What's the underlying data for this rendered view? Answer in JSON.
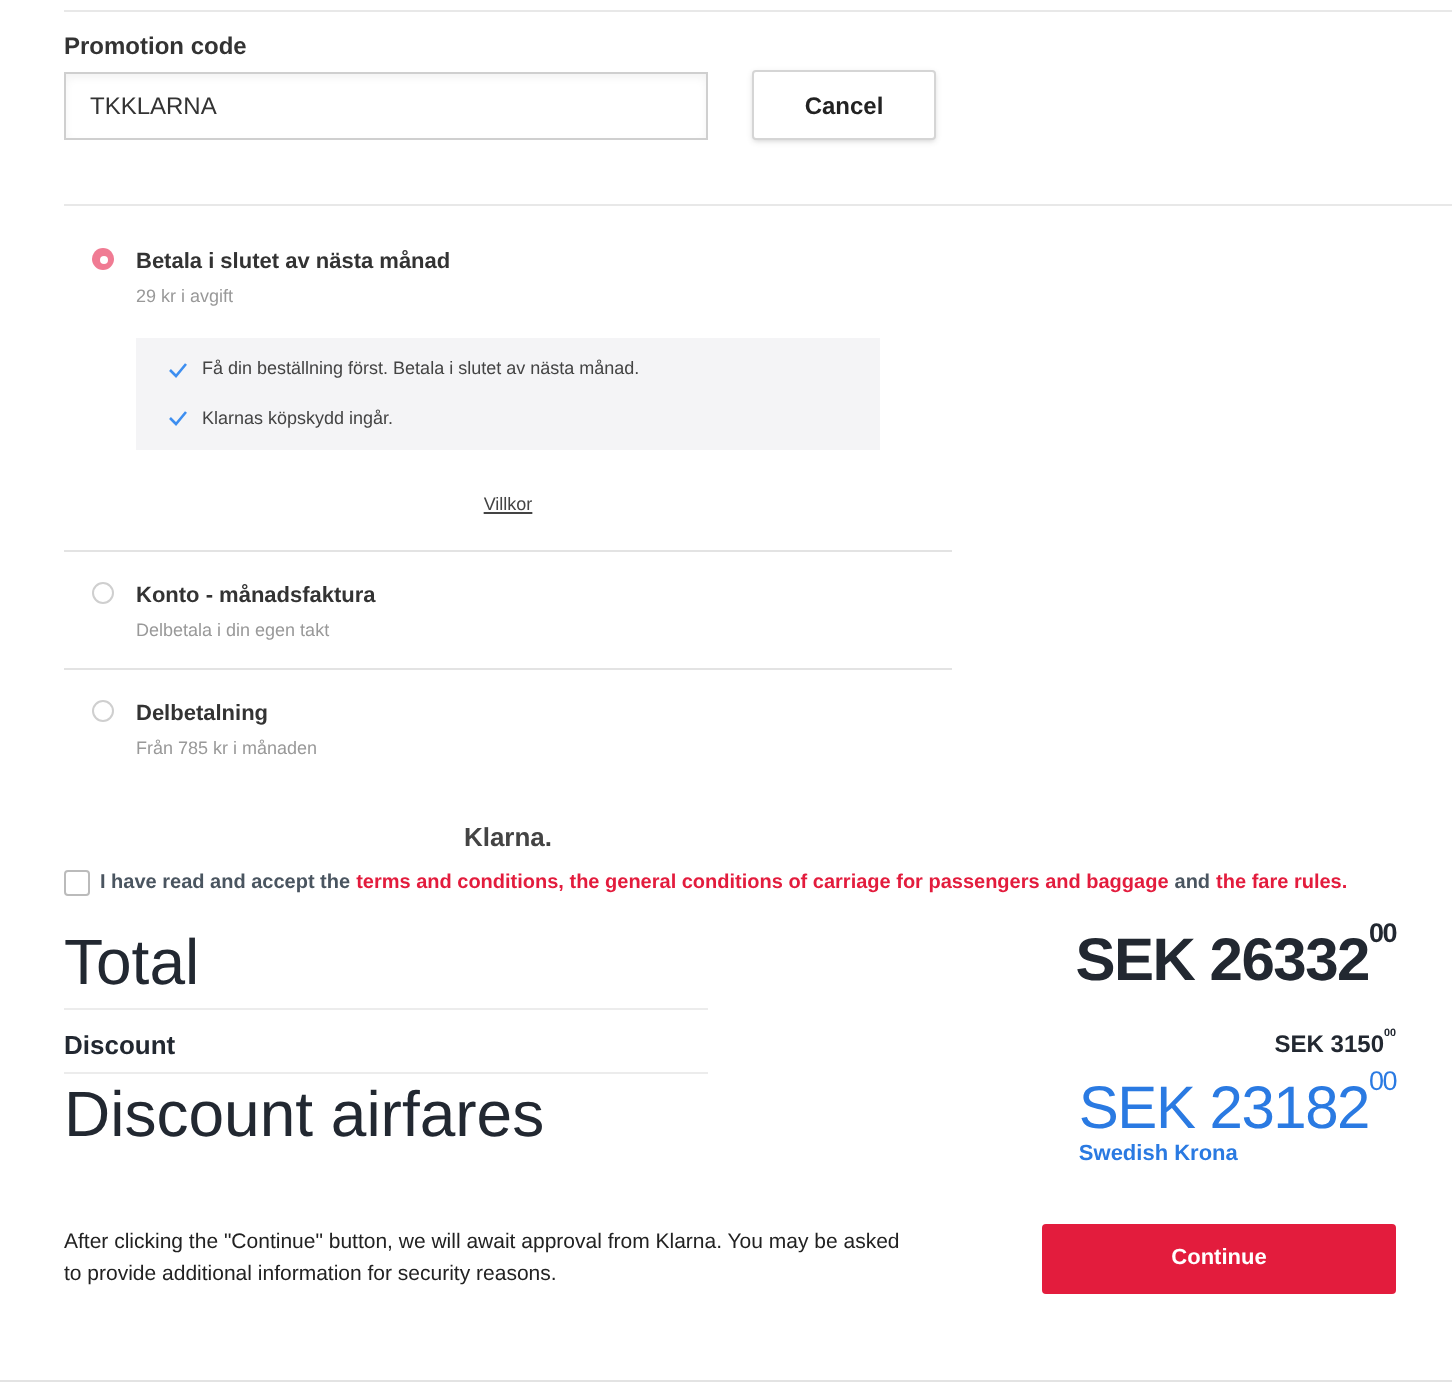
{
  "promotion": {
    "label": "Promotion code",
    "value": "TKKLARNA",
    "cancel_button": "Cancel"
  },
  "payment_options": [
    {
      "title": "Betala i slutet av nästa månad",
      "subtitle": "29 kr i avgift",
      "selected": true,
      "features": [
        "Få din beställning först. Betala i slutet av nästa månad.",
        "Klarnas köpskydd ingår."
      ],
      "link": "Villkor"
    },
    {
      "title": "Konto - månadsfaktura",
      "subtitle": "Delbetala i din egen takt",
      "selected": false
    },
    {
      "title": "Delbetalning",
      "subtitle": "Från 785 kr i månaden",
      "selected": false
    }
  ],
  "provider_logo": "Klarna.",
  "terms": {
    "checked": false,
    "parts": [
      {
        "kind": "text",
        "text": "I have read and accept the"
      },
      {
        "kind": "link",
        "text": "terms and conditions, the general conditions of carriage for passengers and baggage"
      },
      {
        "kind": "text",
        "text": "and"
      },
      {
        "kind": "link",
        "text": "the fare rules."
      }
    ]
  },
  "summary": [
    {
      "kind": "large",
      "label": "Total",
      "amount": "SEK 26332$^{00}$"
    },
    {
      "kind": "small",
      "label": "Discount",
      "amount": "SEK 3150$^{00}$"
    },
    {
      "kind": "highlight",
      "label": "Discount airfares",
      "amount": "SEK 23182$^{00}$",
      "currency_name": "Swedish Krona"
    }
  ],
  "notice": "After clicking the \"Continue\" button, we will await approval from Klarna. You may be asked to provide additional information for security reasons.",
  "continue_button": "Continue"
}
